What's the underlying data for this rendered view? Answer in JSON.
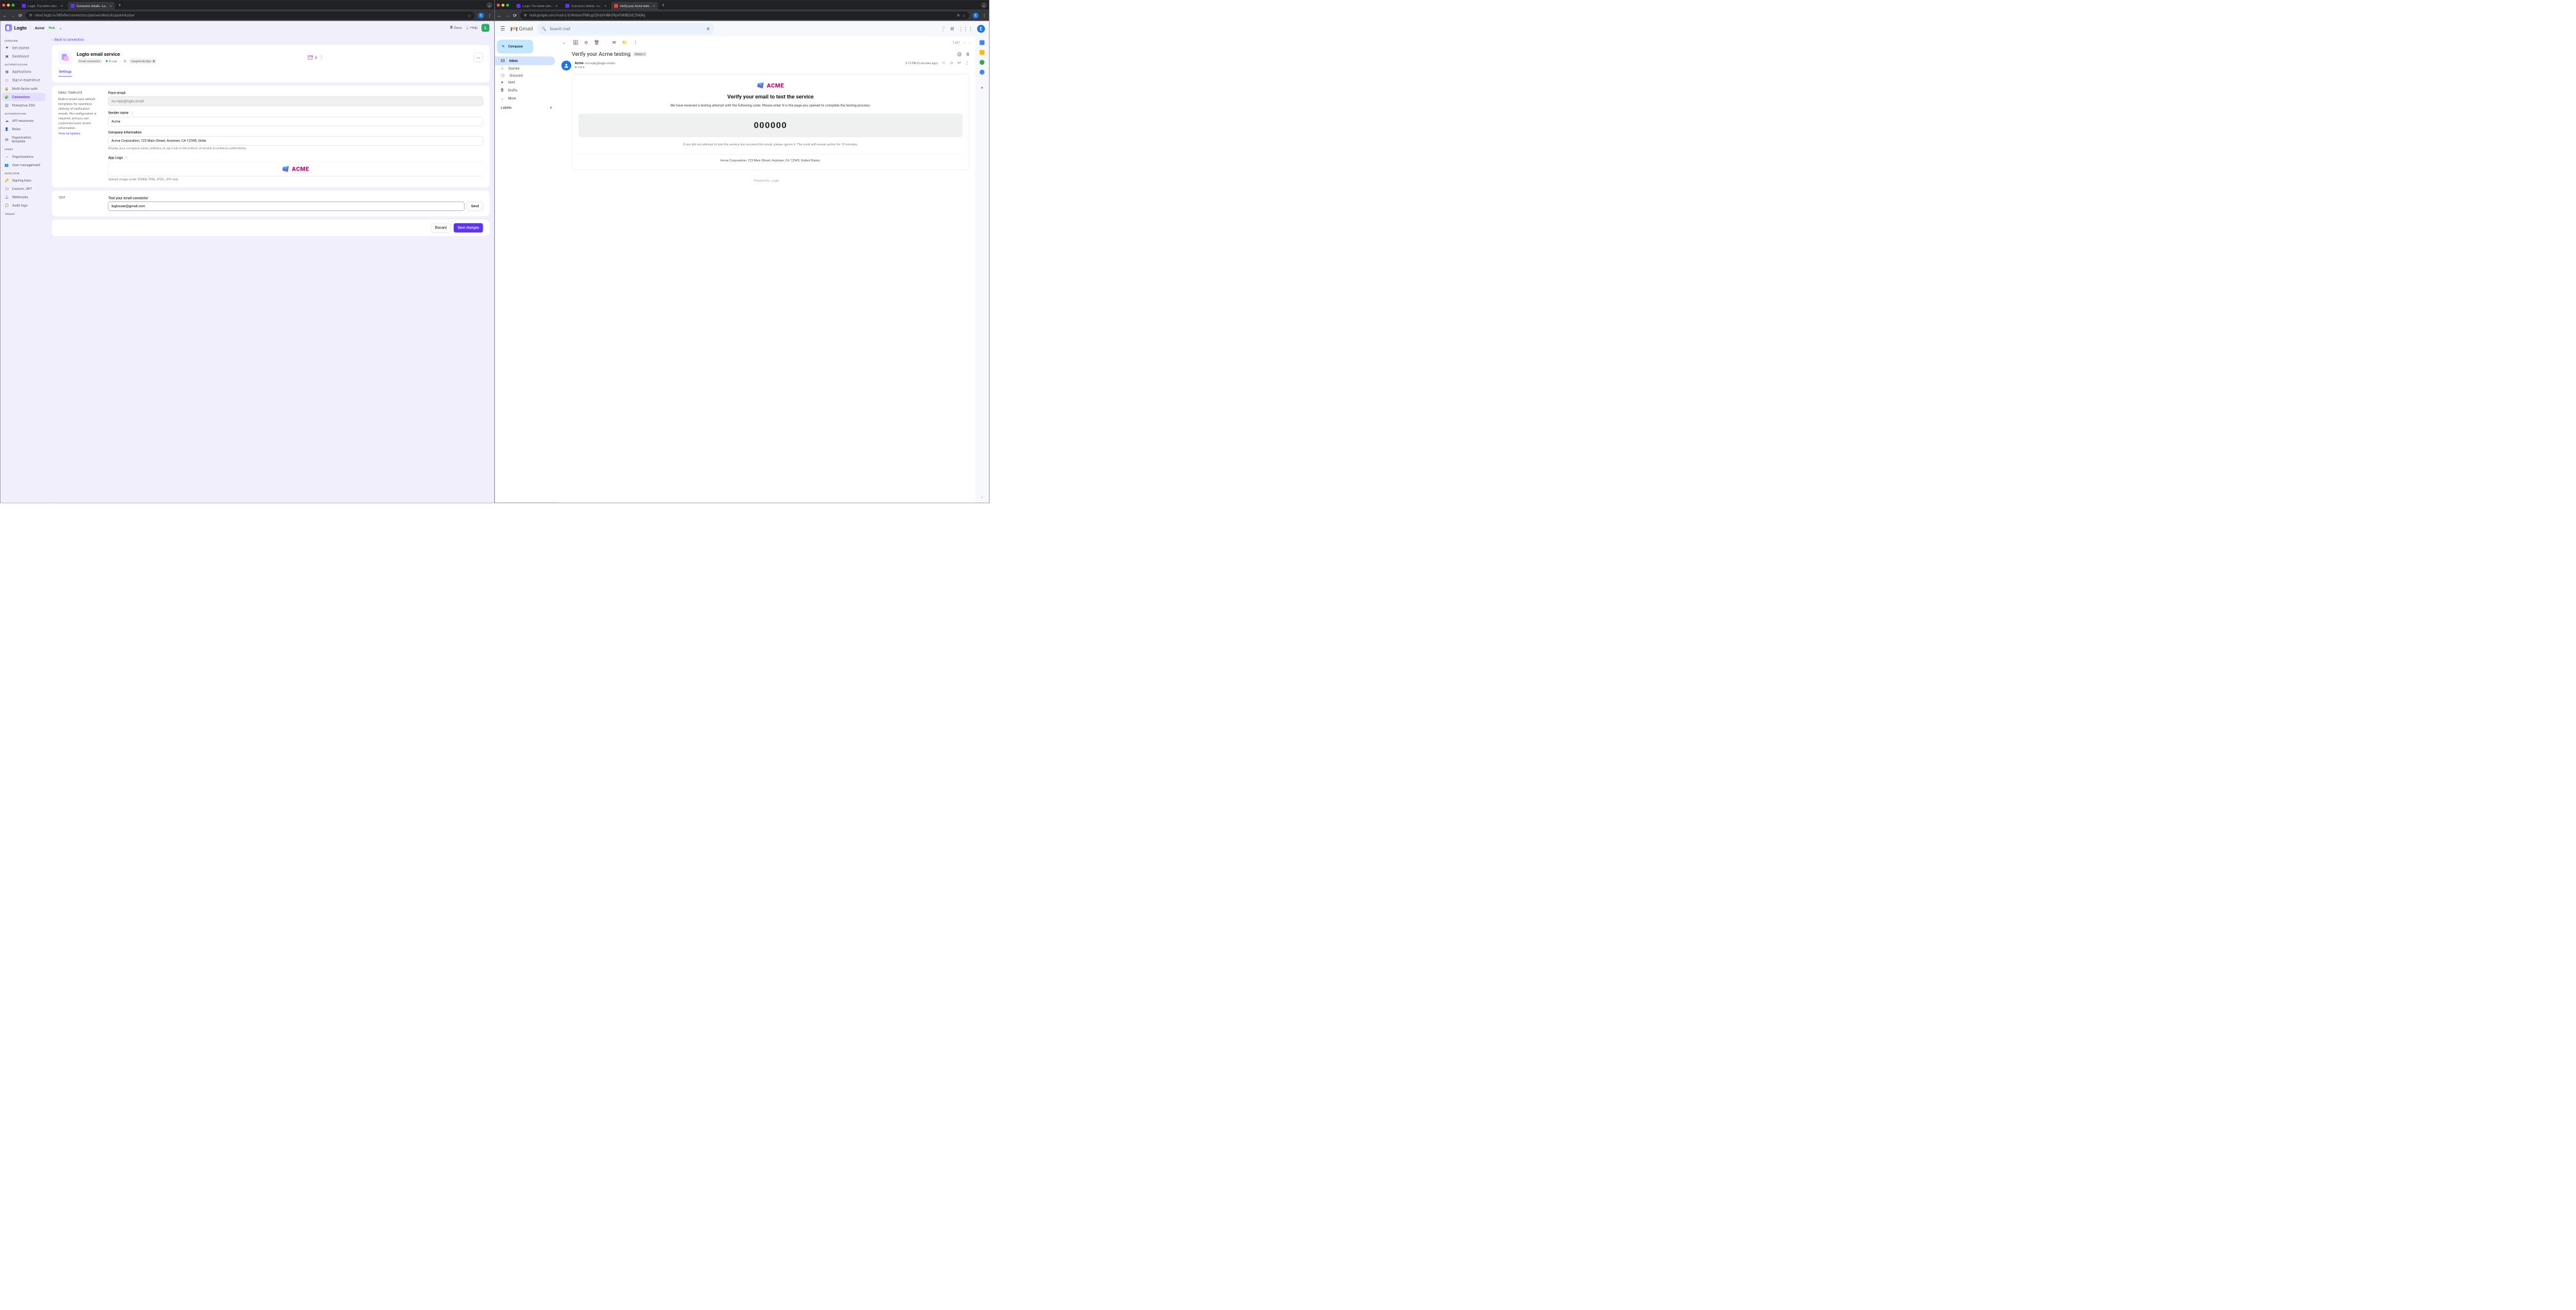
{
  "leftChrome": {
    "tabs": [
      {
        "title": "Logto: The better identity inf",
        "active": false
      },
      {
        "title": "Connector details - Logto Cl",
        "active": true
      }
    ],
    "url": "cloud.logto.io/08fx8w/connectors/passwordless/kzapxemkzdyw",
    "avatarLetter": "E",
    "avatarColor": "#1a73e8"
  },
  "rightChrome": {
    "tabs": [
      {
        "title": "Logto: The better identity inf",
        "active": false
      },
      {
        "title": "Connector details - Logto Cl",
        "active": false
      },
      {
        "title": "Verify your Acme testing - lo",
        "active": true
      }
    ],
    "url": "mail.google.com/mail/u/0/#inbox/FMfcgzQVxbhHBkGRpvFlWlBQdCZtHjNq",
    "avatarLetter": "E",
    "avatarColor": "#1a73e8"
  },
  "logto": {
    "brand": "Logto",
    "tenant": "Acme",
    "tenantBadge": "Prod",
    "docs": "Docs",
    "help": "Help",
    "avatarLetter": "L",
    "sidebar": {
      "overview": "OVERVIEW",
      "getStarted": "Get started",
      "dashboard": "Dashboard",
      "authentication": "AUTHENTICATION",
      "applications": "Applications",
      "signIn": "Sign-in experience",
      "mfa": "Multi-factor auth",
      "connectors": "Connectors",
      "enterprise": "Enterprise SSO",
      "authorization": "AUTHORIZATION",
      "api": "API resources",
      "roles": "Roles",
      "orgTemplate": "Organization template",
      "users": "USERS",
      "organizations": "Organizations",
      "userMgmt": "User management",
      "developer": "DEVELOPER",
      "signingKeys": "Signing keys",
      "customJwt": "Custom JWT",
      "webhooks": "Webhooks",
      "auditLogs": "Audit logs",
      "tenantSec": "TENANT"
    },
    "back": "Back to connectors",
    "connector": {
      "title": "Logto email service",
      "type": "Email connector",
      "status": "In use",
      "idLabel": "ID",
      "id": "kzapxemkzdyw",
      "usage": "0"
    },
    "tabs": {
      "settings": "Settings"
    },
    "form": {
      "sectionTitle": "EMAIL TEMPLATE",
      "sectionDesc": "Built-in email uses default templates for seamless delivery of verification emails. No configuration is required, and you can customize basic brand information.",
      "viewTemplates": "View templates",
      "fromEmailLabel": "From email",
      "fromEmail": "no-reply@logto.email",
      "senderNameLabel": "Sender name",
      "senderName": "Acme",
      "companyLabel": "Company information",
      "company": "Acme Corporation, 123 Main Street, Anytown, CA 12345, Unite",
      "companyHelp": "Display your company name, address, or zip code in the bottom of emails to enhance authenticity.",
      "appLogoLabel": "App Logo",
      "logoHelp": "Upload image under 500KB, PNG, JPEG, JPG only.",
      "acmeName": "ACME"
    },
    "test": {
      "sectionTitle": "TEST",
      "testLabel": "Test your email connector",
      "testEmail": "logtouser@gmail.com",
      "send": "Send"
    },
    "footer": {
      "discard": "Discard",
      "save": "Save changes"
    }
  },
  "gmail": {
    "brand": "Gmail",
    "searchPlaceholder": "Search mail",
    "compose": "Compose",
    "nav": {
      "inbox": "Inbox",
      "starred": "Starred",
      "snoozed": "Snoozed",
      "sent": "Sent",
      "drafts": "Drafts",
      "more": "More"
    },
    "labels": "Labels",
    "pager": "1 of 1",
    "subject": "Verify your Acme testing",
    "inboxChip": "Inbox",
    "from": {
      "name": "Acme",
      "email": "<no-reply@logto.email>",
      "to": "to me",
      "time": "3:15 PM (0 minutes ago)"
    },
    "email": {
      "logoText": "ACME",
      "title": "Verify your email to test the service",
      "desc": "We have received a testing attempt with the following code. Please enter it in the page you opened to complete the testing process.",
      "code": "000000",
      "ignore": "If you did not attempt to test the service but received this email, please ignore it. The code will remain active for 10 minutes.",
      "footer": "Acme Corporation, 123 Main Street, Anytown, CA 12345, United States.",
      "powered": "Powered by ▫ Logto"
    }
  }
}
